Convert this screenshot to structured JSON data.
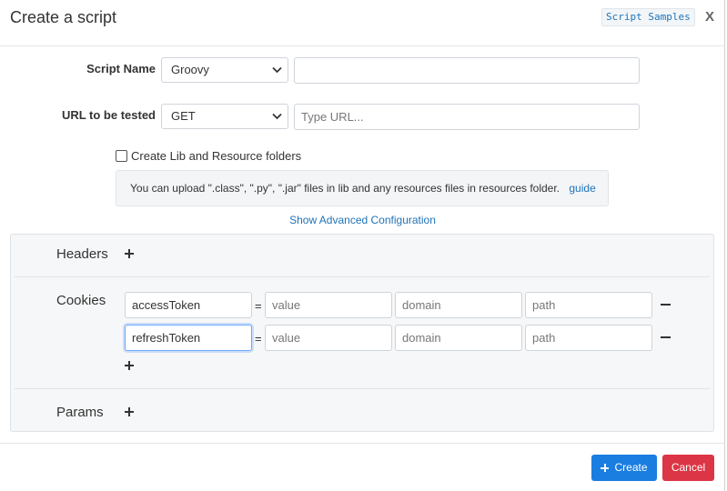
{
  "dialog": {
    "title": "Create a script",
    "samples_label": "Script Samples",
    "close_label": "X"
  },
  "form": {
    "script_name_label": "Script Name",
    "language_selected": "Groovy",
    "script_name_value": "",
    "url_label": "URL to be tested",
    "method_selected": "GET",
    "url_placeholder": "Type URL...",
    "lib_checkbox_label": "Create Lib and Resource folders",
    "lib_checkbox_checked": false,
    "info_text": "You can upload \".class\", \".py\", \".jar\" files in lib and any resources files in resources folder.",
    "guide_link": "guide",
    "advanced_link": "Show Advanced Configuration"
  },
  "advanced": {
    "headers_label": "Headers",
    "cookies_label": "Cookies",
    "params_label": "Params",
    "equals_sign": "=",
    "cookies": [
      {
        "name": "accessToken",
        "value_placeholder": "value",
        "domain_placeholder": "domain",
        "path_placeholder": "path"
      },
      {
        "name": "refreshToken",
        "value_placeholder": "value",
        "domain_placeholder": "domain",
        "path_placeholder": "path"
      }
    ]
  },
  "footer": {
    "create_label": "Create",
    "cancel_label": "Cancel"
  },
  "colors": {
    "primary": "#1a7de0",
    "danger": "#dc3545",
    "link": "#1f73b7"
  }
}
